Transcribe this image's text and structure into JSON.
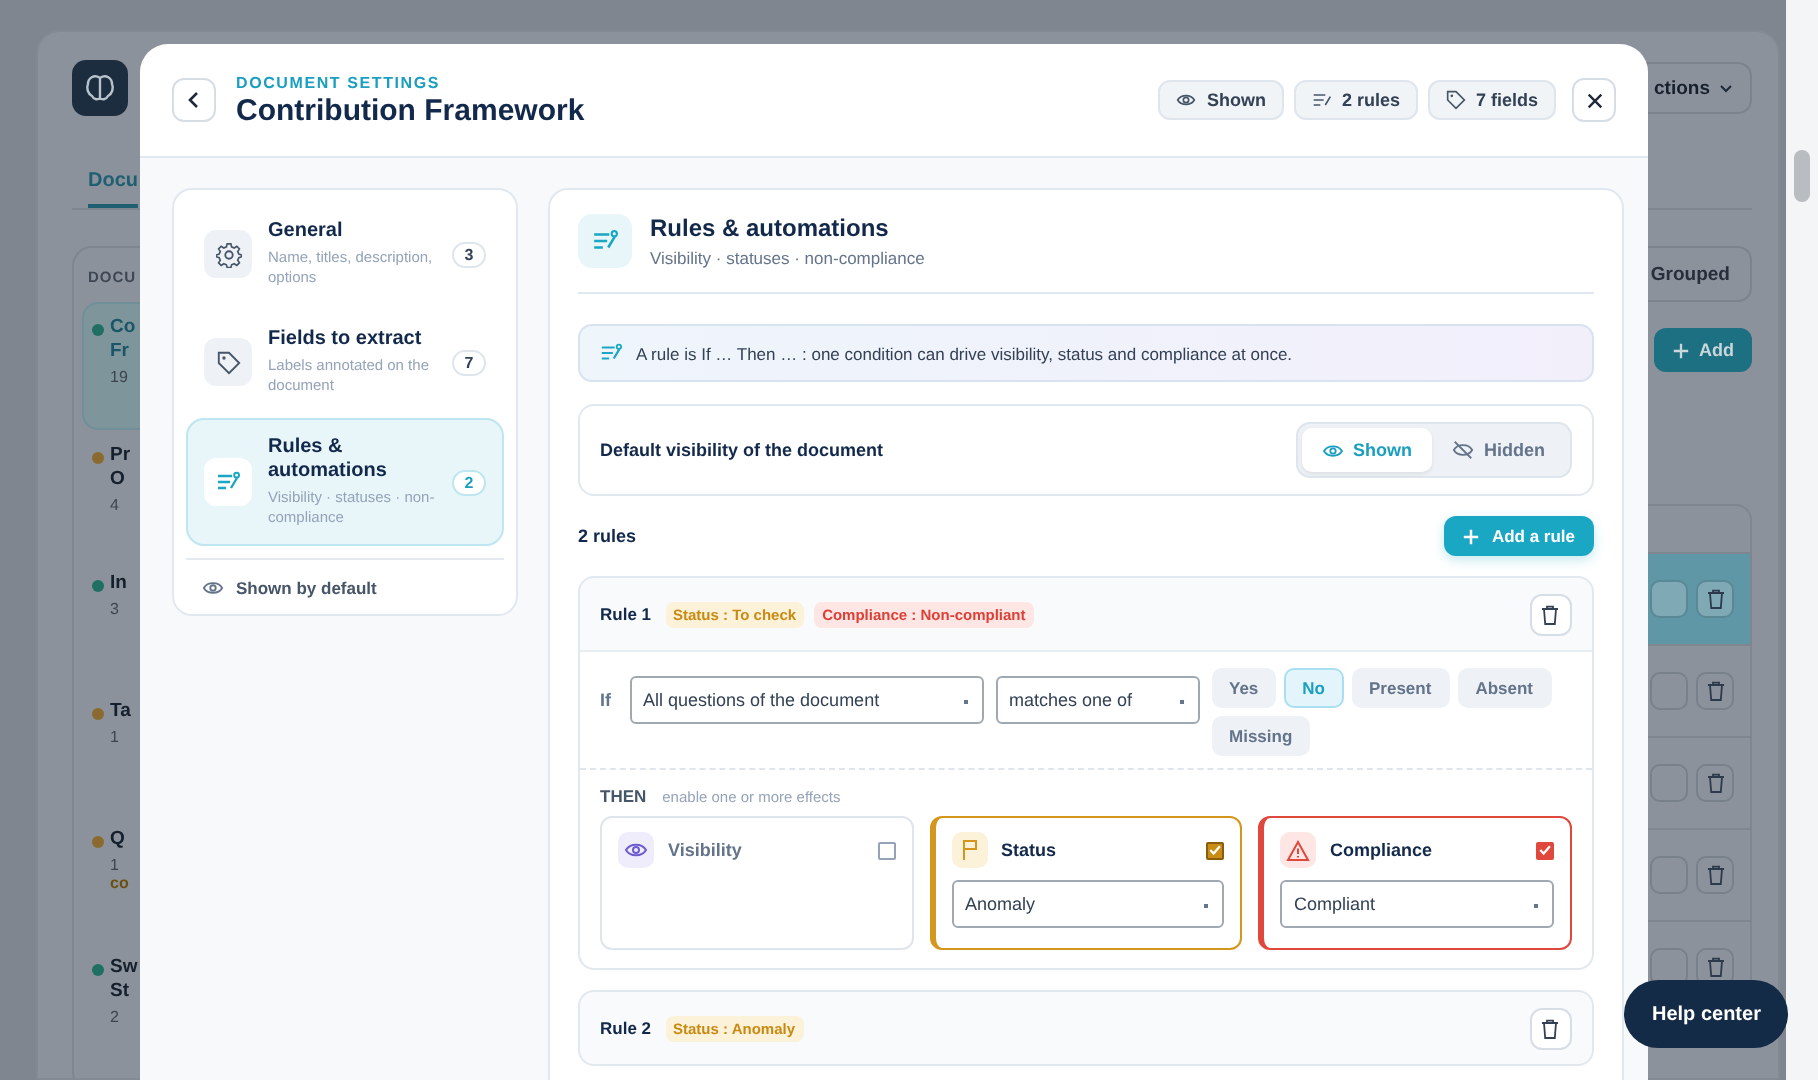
{
  "app": {
    "actions_button": "ctions",
    "tab": "Docu",
    "section_label": "DOCU",
    "grouped_button": "Grouped",
    "add_button": "Add",
    "documents": [
      {
        "title_lines": [
          "Co",
          "Fr"
        ],
        "meta": "19",
        "color": "#1f6f63",
        "selected": true
      },
      {
        "title_lines": [
          "Pr",
          "O"
        ],
        "meta": "4",
        "color": "#8a6a2e",
        "selected": false
      },
      {
        "title_lines": [
          "In"
        ],
        "meta": "3",
        "color": "#1f6f63",
        "selected": false
      },
      {
        "title_lines": [
          "Ta"
        ],
        "meta": "1",
        "color": "#8a6a2e",
        "selected": false
      },
      {
        "title_lines": [
          "Q"
        ],
        "meta": "1",
        "note": "co",
        "color": "#8a6a2e",
        "selected": false
      },
      {
        "title_lines": [
          "Sw",
          "St"
        ],
        "meta": "2",
        "color": "#1f6f63",
        "selected": false
      }
    ],
    "table_rows": [
      {
        "selected": true
      },
      {
        "selected": false
      },
      {
        "selected": false
      },
      {
        "selected": false
      },
      {
        "selected": false
      }
    ]
  },
  "help_button": "Help center",
  "dialog": {
    "eyebrow": "DOCUMENT SETTINGS",
    "title": "Contribution Framework",
    "chips": [
      {
        "kind": "visibility",
        "label": "Shown"
      },
      {
        "kind": "rules",
        "label": "2 rules"
      },
      {
        "kind": "fields",
        "label": "7 fields"
      }
    ],
    "nav": {
      "items": [
        {
          "kind": "general",
          "title": "General",
          "subtitle": "Name, titles, description, options",
          "count": "3",
          "selected": false
        },
        {
          "kind": "fields",
          "title": "Fields to extract",
          "subtitle": "Labels annotated on the document",
          "count": "7",
          "selected": false
        },
        {
          "kind": "rules",
          "title": "Rules & automations",
          "subtitle": "Visibility · statuses · non-compliance",
          "count": "2",
          "selected": true
        }
      ],
      "footer": "Shown by default"
    },
    "panel": {
      "title": "Rules & automations",
      "subtitle": "Visibility · statuses · non-compliance",
      "info": "A rule is If … Then … : one condition can drive visibility, status and compliance at once.",
      "default_visibility": {
        "label": "Default visibility of the document",
        "options": [
          {
            "kind": "shown",
            "label": "Shown",
            "selected": true
          },
          {
            "kind": "hidden",
            "label": "Hidden",
            "selected": false
          }
        ]
      },
      "rules_count": "2 rules",
      "add_rule": "Add a rule"
    },
    "rules": [
      {
        "name": "Rule 1",
        "tags": [
          {
            "kind": "status",
            "label": "Status : To check"
          },
          {
            "kind": "compliance",
            "label": "Compliance : Non-compliant"
          }
        ],
        "if_label": "If",
        "field": "All questions of the document",
        "operator": "matches one of",
        "values": [
          {
            "label": "Yes",
            "selected": false
          },
          {
            "label": "No",
            "selected": true
          },
          {
            "label": "Present",
            "selected": false
          },
          {
            "label": "Absent",
            "selected": false
          },
          {
            "label": "Missing",
            "selected": false
          }
        ],
        "then_label": "THEN",
        "then_hint": "enable one or more effects",
        "effects": [
          {
            "kind": "visibility",
            "label": "Visibility",
            "checked": false
          },
          {
            "kind": "status",
            "label": "Status",
            "checked": true,
            "value": "Anomaly"
          },
          {
            "kind": "compliance",
            "label": "Compliance",
            "checked": true,
            "value": "Compliant"
          }
        ]
      },
      {
        "name": "Rule 2",
        "tags": [
          {
            "kind": "status",
            "label": "Status : Anomaly"
          }
        ]
      }
    ]
  }
}
